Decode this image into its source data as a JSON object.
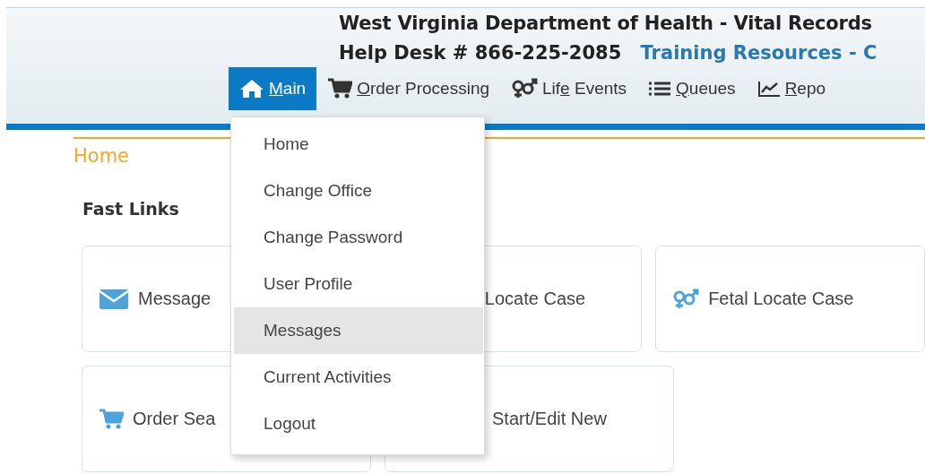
{
  "header": {
    "title": "West Virginia Department of Health - Vital Records",
    "help_desk": "Help Desk # 866-225-2085",
    "link": "Training Resources - C"
  },
  "nav": [
    {
      "kind": "home",
      "key": "M",
      "post": "ain",
      "selected": true
    },
    {
      "kind": "cart",
      "key": "O",
      "post": "rder Processing",
      "selected": false
    },
    {
      "kind": "gender",
      "pre": "Lif",
      "key": "e",
      "post": " Events",
      "selected": false
    },
    {
      "kind": "list",
      "key": "Q",
      "post": "ueues",
      "selected": false
    },
    {
      "kind": "chart",
      "key": "R",
      "post": "epo",
      "selected": false
    }
  ],
  "breadcrumb": "Home",
  "section_title": "Fast Links",
  "cards": [
    [
      {
        "kind": "mail",
        "label": "Message"
      },
      {
        "label": "Locate Case"
      },
      {
        "kind": "gender",
        "label": "Fetal Locate Case"
      }
    ],
    [
      {
        "kind": "cart",
        "label": "Order Sea"
      },
      {
        "label": "Start/Edit New"
      }
    ]
  ],
  "menu": [
    {
      "label": "Home",
      "selected": false
    },
    {
      "label": "Change Office",
      "selected": false
    },
    {
      "label": "Change Password",
      "selected": false
    },
    {
      "label": "User Profile",
      "selected": false
    },
    {
      "label": "Messages",
      "selected": true
    },
    {
      "label": "Current Activities",
      "selected": false
    },
    {
      "label": "Logout",
      "selected": false
    }
  ]
}
